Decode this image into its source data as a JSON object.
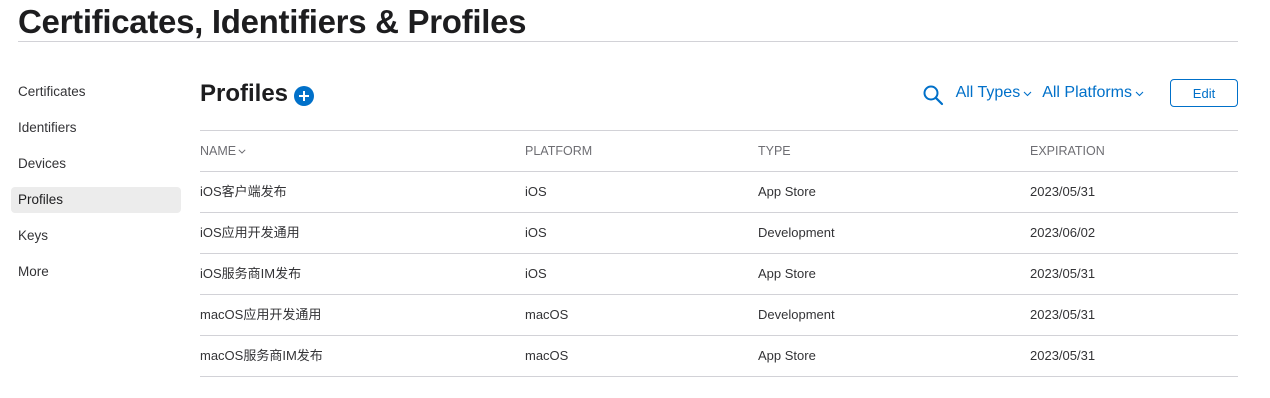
{
  "header": {
    "title": "Certificates, Identifiers & Profiles"
  },
  "sidebar": {
    "items": [
      {
        "label": "Certificates"
      },
      {
        "label": "Identifiers"
      },
      {
        "label": "Devices"
      },
      {
        "label": "Profiles",
        "active": true
      },
      {
        "label": "Keys"
      },
      {
        "label": "More"
      }
    ]
  },
  "main": {
    "title": "Profiles",
    "add_icon": "plus-circle-icon",
    "search_icon": "magnifier-icon",
    "filters": {
      "types_label": "All Types",
      "platforms_label": "All Platforms"
    },
    "edit_label": "Edit",
    "accent_color": "#0070c9"
  },
  "table": {
    "columns": [
      "NAME",
      "PLATFORM",
      "TYPE",
      "EXPIRATION"
    ],
    "rows": [
      {
        "name": "iOS客户端发布",
        "platform": "iOS",
        "type": "App Store",
        "expiration": "2023/05/31"
      },
      {
        "name": "iOS应用开发通用",
        "platform": "iOS",
        "type": "Development",
        "expiration": "2023/06/02"
      },
      {
        "name": "iOS服务商IM发布",
        "platform": "iOS",
        "type": "App Store",
        "expiration": "2023/05/31"
      },
      {
        "name": "macOS应用开发通用",
        "platform": "macOS",
        "type": "Development",
        "expiration": "2023/05/31"
      },
      {
        "name": "macOS服务商IM发布",
        "platform": "macOS",
        "type": "App Store",
        "expiration": "2023/05/31"
      }
    ]
  }
}
